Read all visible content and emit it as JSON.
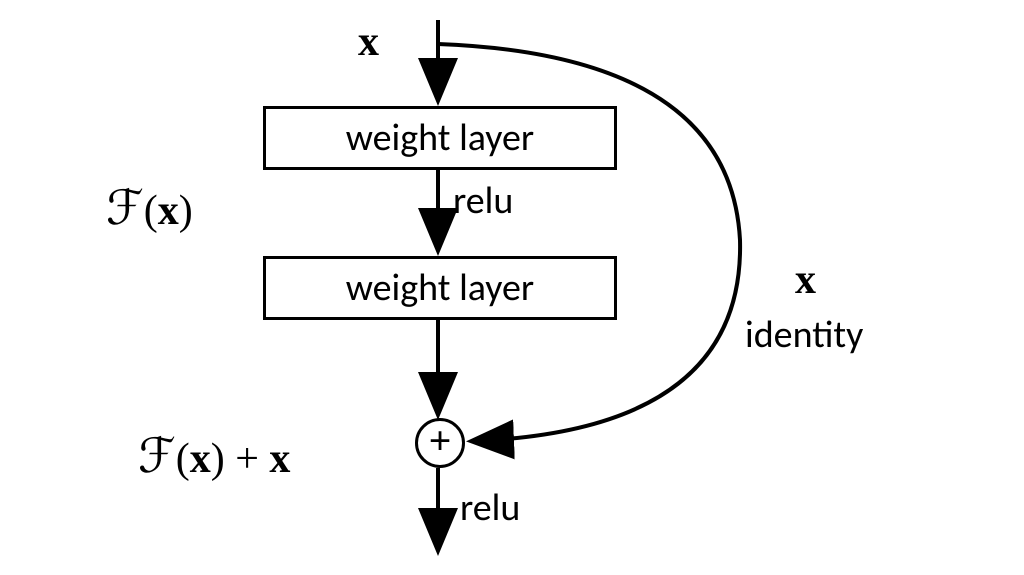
{
  "input": {
    "label": "x"
  },
  "block1": {
    "text": "weight layer"
  },
  "activation1": {
    "label": "relu"
  },
  "block2": {
    "text": "weight layer"
  },
  "left_label": {
    "fx": "ℱ",
    "paren_open": "(",
    "x": "x",
    "paren_close": ")"
  },
  "skip": {
    "x": "x",
    "identity": "identity"
  },
  "sum": {
    "symbol": "+"
  },
  "output_label": {
    "fx": "ℱ",
    "paren_open": "(",
    "x1": "x",
    "paren_close": ")",
    "plus": " + ",
    "x2": "x"
  },
  "activation2": {
    "label": "relu"
  }
}
